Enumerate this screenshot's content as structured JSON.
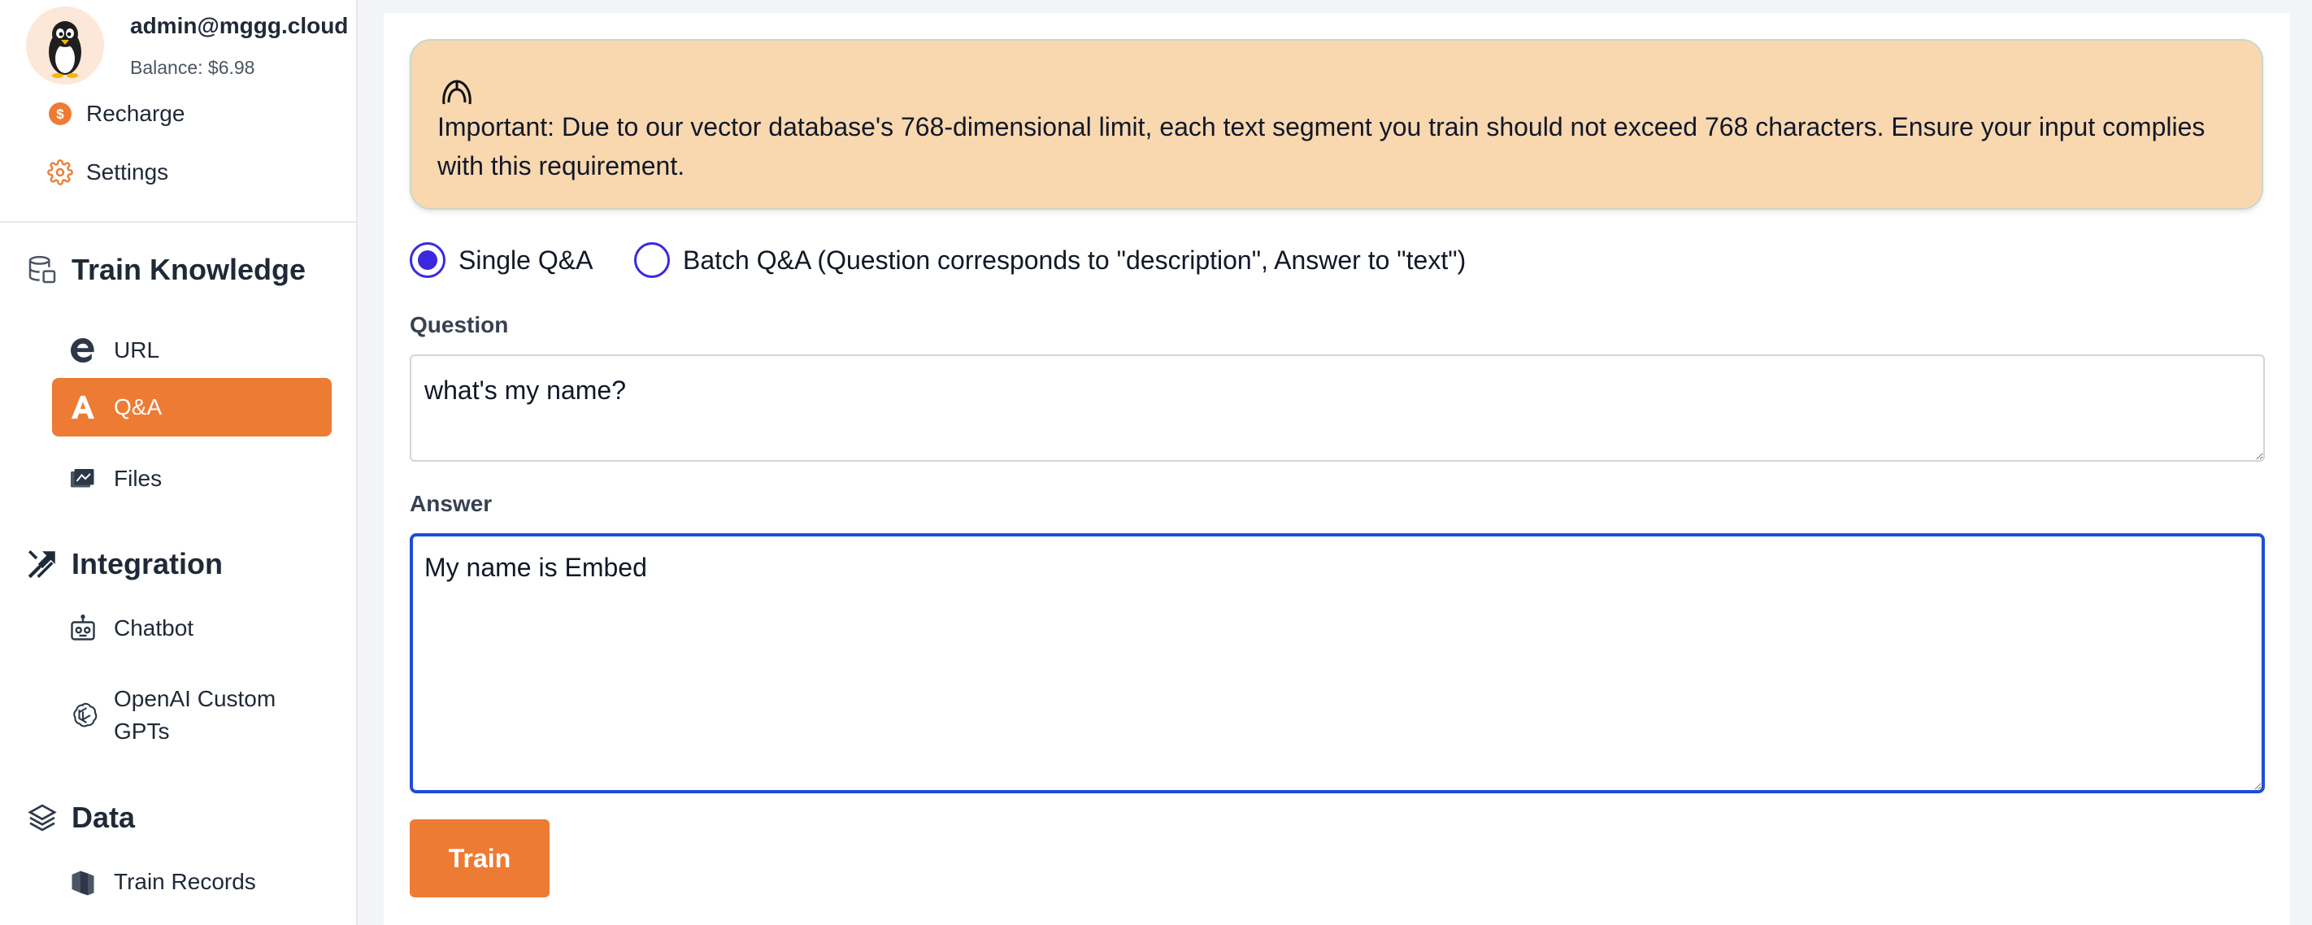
{
  "profile": {
    "email": "admin@mggg.cloud",
    "balance": "Balance: $6.98"
  },
  "menu": {
    "recharge": "Recharge",
    "settings": "Settings"
  },
  "sections": {
    "train_knowledge": {
      "title": "Train Knowledge",
      "items": [
        {
          "label": "URL",
          "icon": "edge-e-icon"
        },
        {
          "label": "Q&A",
          "icon": "letter-a-icon",
          "active": true
        },
        {
          "label": "Files",
          "icon": "files-icon"
        }
      ]
    },
    "integration": {
      "title": "Integration",
      "items": [
        {
          "label": "Chatbot",
          "icon": "robot-icon"
        },
        {
          "label": "OpenAI Custom GPTs",
          "icon": "openai-icon"
        }
      ]
    },
    "data": {
      "title": "Data",
      "items": [
        {
          "label": "Train Records",
          "icon": "records-icon"
        }
      ]
    }
  },
  "notice": {
    "icon": "helmet-icon",
    "text": "Important: Due to our vector database's 768-dimensional limit, each text segment you train should not exceed 768 characters. Ensure your input complies with this requirement."
  },
  "mode": {
    "selected": "single",
    "single_label": "Single Q&A",
    "batch_label": "Batch Q&A (Question corresponds to \"description\", Answer to \"text\")"
  },
  "form": {
    "question_label": "Question",
    "question_value": "what's my name?",
    "answer_label": "Answer",
    "answer_value": "My name is Embed",
    "submit_label": "Train"
  },
  "colors": {
    "accent": "#ed7b34",
    "notice_bg": "#f9d8b0",
    "radio": "#3b28e0",
    "focus_border": "#1d4ed8"
  }
}
